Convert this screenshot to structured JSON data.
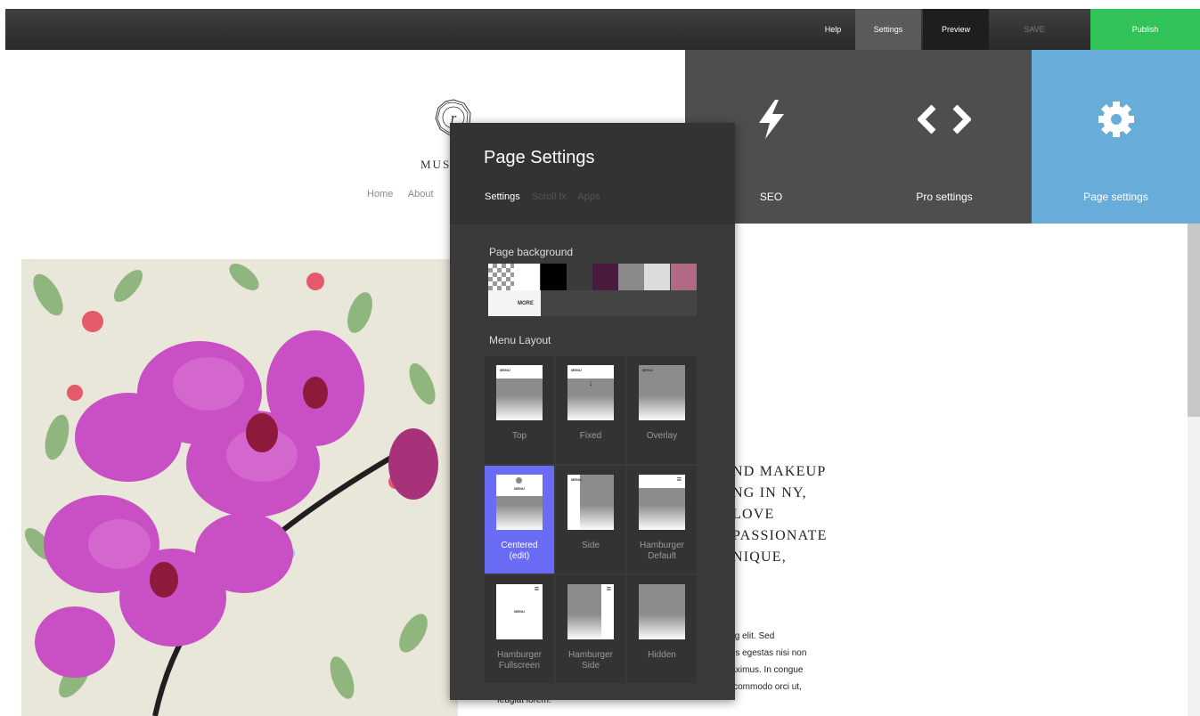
{
  "toolbar": {
    "help": "Help",
    "settings": "Settings",
    "preview": "Preview",
    "save": "SAVE",
    "publish": "Publish",
    "publish_color": "#31c35a"
  },
  "site": {
    "logo_letter": "r",
    "name": "MUS",
    "nav": [
      "Home",
      "About"
    ],
    "headline": [
      "ND MAKEUP",
      "NG IN NY,",
      "LOVE",
      "PASSIONATE",
      "NIQUE,"
    ],
    "body": [
      "cing elit. Sed",
      "attis egestas nisi non",
      "maximus. In congue",
      "e, commodo orci ut,"
    ],
    "body_tail": "feugiat lorem."
  },
  "tiles": [
    {
      "label": "SEO",
      "icon": "lightning-icon"
    },
    {
      "label": "Pro settings",
      "icon": "code-brackets-icon"
    },
    {
      "label": "Page settings",
      "icon": "gear-icon",
      "active_color": "#68acd9"
    }
  ],
  "panel": {
    "title": "Page Settings",
    "tabs": [
      "Settings",
      "Scroll fx",
      "Apps"
    ],
    "page_background_label": "Page background",
    "swatches": [
      "transparent",
      "#ffffff",
      "#000000",
      "#3b3b3b",
      "#4a1a3b",
      "#8a8a8a",
      "#dcdcdc",
      "#b06a86"
    ],
    "more_label": "MORE",
    "menu_layout_label": "Menu Layout",
    "layouts": [
      {
        "name": "Top"
      },
      {
        "name": "Fixed"
      },
      {
        "name": "Overlay"
      },
      {
        "name": "Centered",
        "name2": "(edit)",
        "active": true
      },
      {
        "name": "Side"
      },
      {
        "name": "Hamburger",
        "name2": "Default"
      },
      {
        "name": "Hamburger",
        "name2": "Fullscreen"
      },
      {
        "name": "Hamburger",
        "name2": "Side"
      },
      {
        "name": "Hidden"
      }
    ],
    "thumb_menu_text": "MENU",
    "fixed_arrow": "↓",
    "hamburger_glyph": "≡",
    "active_color": "#6b6cf5"
  }
}
